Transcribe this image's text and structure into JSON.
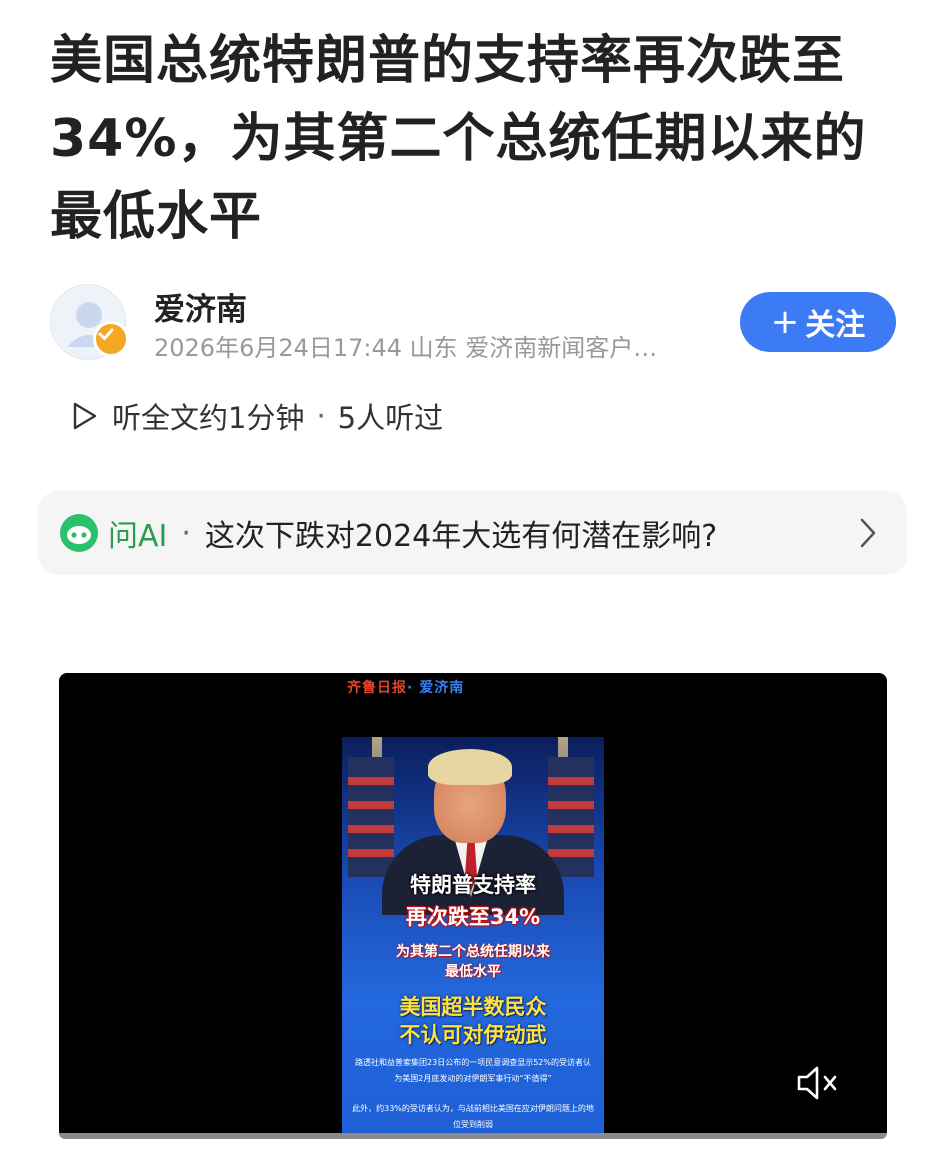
{
  "article": {
    "headline": "美国总统特朗普的支持率再次跌至34%，为其第二个总统任期以来的最低水平"
  },
  "author": {
    "name": "爱济南",
    "meta": "2026年6月24日17:44 山东 爱济南新闻客户…",
    "follow_label": "关注"
  },
  "listen": {
    "label": "听全文约1分钟",
    "separator": "·",
    "count": "5人听过"
  },
  "ai_bar": {
    "label": "问AI",
    "separator": "·",
    "question": "这次下跌对2024年大选有何潜在影响?"
  },
  "video": {
    "brand": "齐鲁日报",
    "brand_sub": "· 爱济南",
    "line1": "特朗普支持率",
    "line2": "再次跌至34%",
    "line3": "为其第二个总统任期以来",
    "line4": "最低水平",
    "line5": "美国超半数民众",
    "line6": "不认可对伊动武",
    "small1": "路透社和益普索集团23日公布的一项民意调查显示52%的受访者认为美国2月底发动的对伊朗军事行动“不值得”",
    "small2": "此外，约33%的受访者认为，与战前相比美国在应对伊朗问题上的地位受到削弱",
    "muted": true
  },
  "colors": {
    "accent": "#3d7af5",
    "ai_green": "#2bc06a",
    "meta_gray": "#999999"
  },
  "icons": [
    "play-icon",
    "avatar-placeholder-icon",
    "verified-badge-icon",
    "ai-logo-icon",
    "chevron-right-icon",
    "mute-icon"
  ]
}
